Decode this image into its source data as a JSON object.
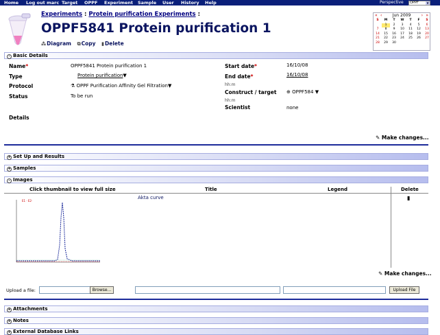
{
  "nav": {
    "items": [
      "Home",
      "Log out marc",
      "Target",
      "OPPF",
      "Experiment",
      "Sample",
      "User",
      "History",
      "Help"
    ],
    "perspective_label": "Perspective",
    "perspective_value": "OPPF"
  },
  "header": {
    "breadcrumb_1": "Experiments",
    "breadcrumb_sep": ":",
    "breadcrumb_2": "Protein purification Experiments",
    "breadcrumb_end": ":",
    "title": "OPPF5841 Protein purification 1",
    "actions": {
      "diagram": "Diagram",
      "copy": "Copy",
      "delete": "Delete"
    }
  },
  "calendar": {
    "month": "Jun 2009",
    "day_headers": [
      "S",
      "M",
      "T",
      "W",
      "T",
      "F",
      "S"
    ],
    "days": [
      "",
      "1",
      "2",
      "3",
      "4",
      "5",
      "6",
      "7",
      "8",
      "9",
      "10",
      "11",
      "12",
      "13",
      "14",
      "15",
      "16",
      "17",
      "18",
      "19",
      "20",
      "21",
      "22",
      "23",
      "24",
      "25",
      "26",
      "27",
      "28",
      "29",
      "30",
      "",
      "",
      "",
      ""
    ],
    "today": "1"
  },
  "basic": {
    "section_title": "Basic Details",
    "name_label": "Name",
    "name_value": "OPPF5841 Protein purification 1",
    "type_label": "Type",
    "type_value": "Protein purification",
    "protocol_label": "Protocol",
    "protocol_value": "OPPF Purification Affinity Gel Filtration",
    "status_label": "Status",
    "status_value": "To be run",
    "details_label": "Details",
    "start_label": "Start date",
    "start_value": "16/10/08",
    "end_label": "End date",
    "end_value": "16/10/08",
    "unit_1": "hh:m",
    "construct_label": "Construct / target",
    "construct_value": "OPPF584",
    "unit_2": "hh:m",
    "scientist_label": "Scientist",
    "scientist_value": "none",
    "make_changes": "Make changes..."
  },
  "sections": {
    "setup": "Set Up and Results",
    "samples": "Samples",
    "images": "Images",
    "attachments": "Attachments",
    "notes": "Notes",
    "external": "External Database Links"
  },
  "images": {
    "col_thumb": "Click thumbnail to view full size",
    "col_title": "Title",
    "col_legend": "Legend",
    "col_delete": "Delete",
    "row_title": "Akta curve",
    "make_changes": "Make changes...",
    "upload_label": "Upload a file:",
    "browse": "Browse...",
    "upload_button": "Upload File"
  },
  "colors": {
    "nav_bg": "#0a1f7a",
    "title": "#0b1560",
    "section_border": "#a6ade0",
    "required": "#cc0000"
  }
}
